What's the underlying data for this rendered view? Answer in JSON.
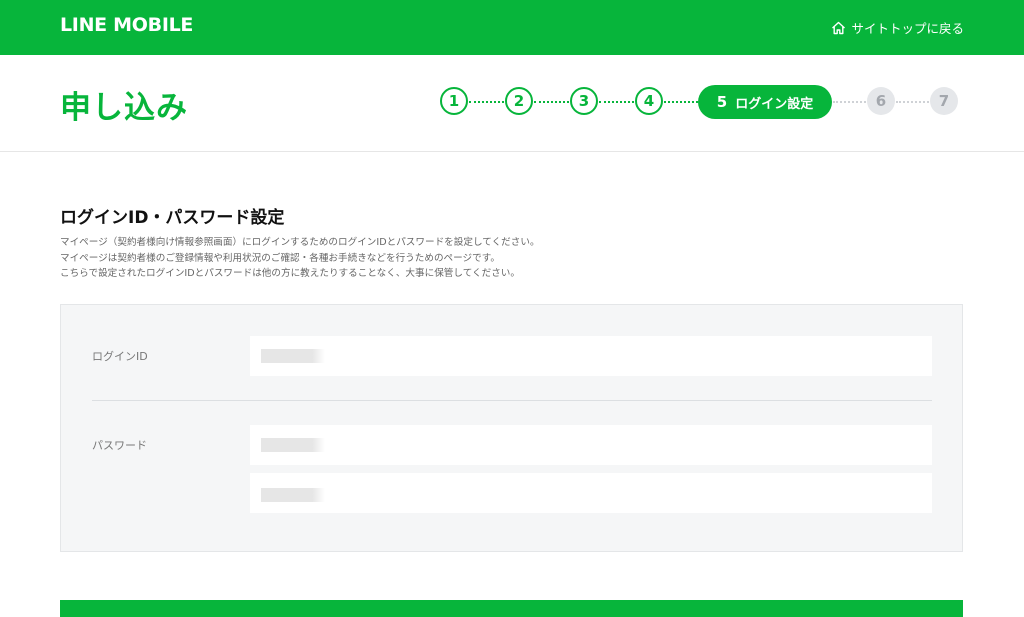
{
  "header": {
    "logo": "LINE MOBILE",
    "back_link": "サイトトップに戻る",
    "back_icon": "home-icon"
  },
  "page": {
    "title": "申し込み"
  },
  "steps": {
    "items": [
      "1",
      "2",
      "3",
      "4",
      "5",
      "6",
      "7"
    ],
    "current_number": "5",
    "current_label": "ログイン設定"
  },
  "section": {
    "title": "ログインID・パスワード設定",
    "description": [
      "マイページ（契約者様向け情報参照画面）にログインするためのログインIDとパスワードを設定してください。",
      "マイページは契約者様のご登録情報や利用状況のご確認・各種お手続きなどを行うためのページです。",
      "こちらで設定されたログインIDとパスワードは他の方に教えたりすることなく、大事に保管してください。"
    ]
  },
  "form": {
    "login_id_label": "ログインID",
    "password_label": "パスワード"
  },
  "colors": {
    "brand_green": "#07b53b",
    "inactive_step": "#e5e7ea"
  }
}
